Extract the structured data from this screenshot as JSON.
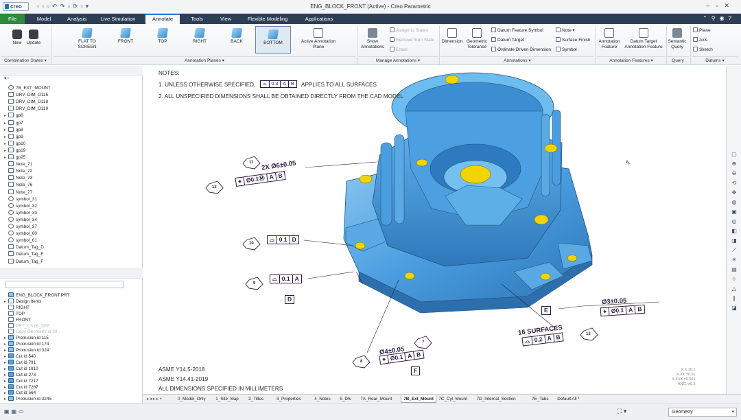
{
  "titlebar": {
    "logo": "creo",
    "title": "ENG_BLOCK_FRONT (Active) - Creo Parametric"
  },
  "tabs": [
    {
      "label": "File"
    },
    {
      "label": "Model"
    },
    {
      "label": "Analysis"
    },
    {
      "label": "Live Simulation"
    },
    {
      "label": "Annotate",
      "active": true
    },
    {
      "label": "Tools"
    },
    {
      "label": "View"
    },
    {
      "label": "Flexible Modeling"
    },
    {
      "label": "Applications"
    }
  ],
  "ribbon": {
    "combination": {
      "new": "New",
      "update": "Update",
      "label": "Combination States ▾"
    },
    "planes": {
      "flat": "FLAT TO SCREEN",
      "front": "FRONT",
      "top": "TOP",
      "right": "RIGHT",
      "back": "BACK",
      "bottom": "BOTTOM",
      "active": "Active Annotation Plane",
      "label": "Annotation Planes ▾"
    },
    "manage": {
      "show": "Show Annotations",
      "assign": "Assign to States",
      "remove": "Remove from State",
      "erase": "Erase",
      "label": "Manage Annotations ▾"
    },
    "annotations": {
      "dimension": "Dimension",
      "geom_tol": "Geometric Tolerance",
      "datum_feature": "Datum Feature Symbol",
      "datum_target": "Datum Target",
      "ordinate": "Ordinate Driven Dimension",
      "note": "Note ▾",
      "surface_finish": "Surface Finish",
      "symbol": "Symbol",
      "label": "Annotations ▾"
    },
    "features": {
      "annot_feature": "Annotation Feature",
      "datum_target_feature": "Datum Target Annotation Feature",
      "label": "Annotation Features ▾"
    },
    "query": {
      "semantic": "Semantic Query",
      "label": "Query"
    },
    "datums": {
      "plane": "Plane",
      "axis": "Axis",
      "sketch": "Sketch",
      "label": "Datums ▾"
    }
  },
  "tree_top": [
    {
      "t": "7B_EXT_MOUNT",
      "i": "sym"
    },
    {
      "t": "DRV_DIM_D115",
      "i": ""
    },
    {
      "t": "DRV_DIM_D118",
      "i": ""
    },
    {
      "t": "DRV_DIM_D119",
      "i": ""
    },
    {
      "t": "gp6",
      "i": "",
      "e": "▸"
    },
    {
      "t": "gp7",
      "i": "",
      "e": "▸"
    },
    {
      "t": "gp8",
      "i": "",
      "e": "▸"
    },
    {
      "t": "gp9",
      "i": "",
      "e": "▸"
    },
    {
      "t": "gp10",
      "i": "",
      "e": "▸"
    },
    {
      "t": "gp19",
      "i": "",
      "e": "▸"
    },
    {
      "t": "gp25",
      "i": "",
      "e": "▸"
    },
    {
      "t": "Note_71",
      "i": ""
    },
    {
      "t": "Note_72",
      "i": ""
    },
    {
      "t": "Note_73",
      "i": ""
    },
    {
      "t": "Note_76",
      "i": ""
    },
    {
      "t": "Note_77",
      "i": ""
    },
    {
      "t": "symbol_31",
      "i": "sym"
    },
    {
      "t": "symbol_32",
      "i": "sym"
    },
    {
      "t": "symbol_33",
      "i": "sym"
    },
    {
      "t": "symbol_34",
      "i": "sym"
    },
    {
      "t": "symbol_37",
      "i": "sym"
    },
    {
      "t": "symbol_60",
      "i": "sym"
    },
    {
      "t": "symbol_61",
      "i": "sym"
    },
    {
      "t": "Datum_Tag_D",
      "i": ""
    },
    {
      "t": "Datum_Tag_E",
      "i": ""
    },
    {
      "t": "Datum_Tag_F",
      "i": ""
    }
  ],
  "tree_bottom": [
    {
      "t": "ENG_BLOCK_FRONT.PRT",
      "i": "prot",
      "e": ""
    },
    {
      "t": "Design Items",
      "i": "",
      "e": "▸"
    },
    {
      "t": "RIGHT",
      "i": "",
      "e": ""
    },
    {
      "t": "TOP",
      "i": "",
      "e": ""
    },
    {
      "t": "FRONT",
      "i": "",
      "e": ""
    },
    {
      "t": "PRT_CSYS_DEF",
      "i": "",
      "e": "",
      "d": true
    },
    {
      "t": "Copy Geometry id 39",
      "i": "",
      "e": "",
      "d": true
    },
    {
      "t": "Protrusion id 115",
      "i": "prot",
      "e": "▸"
    },
    {
      "t": "Protrusion id 174",
      "i": "prot",
      "e": "▸"
    },
    {
      "t": "Protrusion id 324",
      "i": "prot",
      "e": "▸"
    },
    {
      "t": "Cut id 540",
      "i": "cut",
      "e": "▸"
    },
    {
      "t": "Cut id 791",
      "i": "cut",
      "e": "▸"
    },
    {
      "t": "Cut id 1810",
      "i": "cut",
      "e": "▸"
    },
    {
      "t": "Cut id 273",
      "i": "cut",
      "e": "▸"
    },
    {
      "t": "Cut id 7217",
      "i": "cut",
      "e": "▸"
    },
    {
      "t": "Cut id 7287",
      "i": "cut",
      "e": "▸"
    },
    {
      "t": "Cut id 564",
      "i": "cut",
      "e": "▸"
    },
    {
      "t": "Protrusion id 3245",
      "i": "prot",
      "e": "▸"
    }
  ],
  "drawing": {
    "notes_title": "NOTES:",
    "note1a": "1. UNLESS OTHERWISE SPECIFIED,",
    "note1_val": "0.3",
    "note1_a": "A",
    "note1_b": "B",
    "note1b": "APPLIES TO ALL SURFACES",
    "note2": "2. ALL UNSPECIFIED DIMENSIONS SHALL BE OBTAINED DIRECTLY FROM THE CAD MODEL",
    "std1": "ASME Y14.5-2018",
    "std2": "ASME Y14.41-2019",
    "std3": "ALL DIMENSIONS SPECIFIED IN MILLIMETERS",
    "dim_holes": "2X Ø6±0.05",
    "fcf12_val": "Ø0.1Ⓜ",
    "fcf12_a": "A",
    "fcf12_b": "B",
    "fcf10_val": "0.1",
    "fcf10_d": "D",
    "fcf9_val": "0.1",
    "fcf9_a": "A",
    "datum_d": "D",
    "dim_e": "Ø3±0.05",
    "fcf_e_val": "Ø0.1",
    "fcf_e_a": "A",
    "fcf_e_b": "B",
    "datum_e": "E",
    "surf16": "16 SURFACES",
    "fcf13_val": "0.2",
    "fcf13_a": "A",
    "fcf13_b": "B",
    "dim_f": "Ø4±0.05",
    "fcf8_val": "Ø0.1",
    "fcf8_a": "A",
    "fcf8_b": "B",
    "datum_f": "F",
    "tag11": "11",
    "tag12": "12",
    "tag10": "10",
    "tag9": "9",
    "tag7": "7",
    "tag13": "13",
    "tag8": "8",
    "tol": [
      "X.X ±0.1",
      "X.XX ±0.01",
      "X.XXX ±0.001",
      "ANG. ±0.5"
    ]
  },
  "sheets": [
    "0_Model_Only",
    "1_Site_Map",
    "2_Titles",
    "3_Properties",
    "4_Notes",
    "5_Dfs",
    "7A_Rear_Mount",
    "7B_Ext_Mount",
    "7C_Cyl_Mount",
    "7D_Internal_Section",
    "7E_Tabs",
    "Default All *"
  ],
  "active_sheet": "7B_Ext_Mount",
  "status": {
    "filter": "Geometry"
  }
}
